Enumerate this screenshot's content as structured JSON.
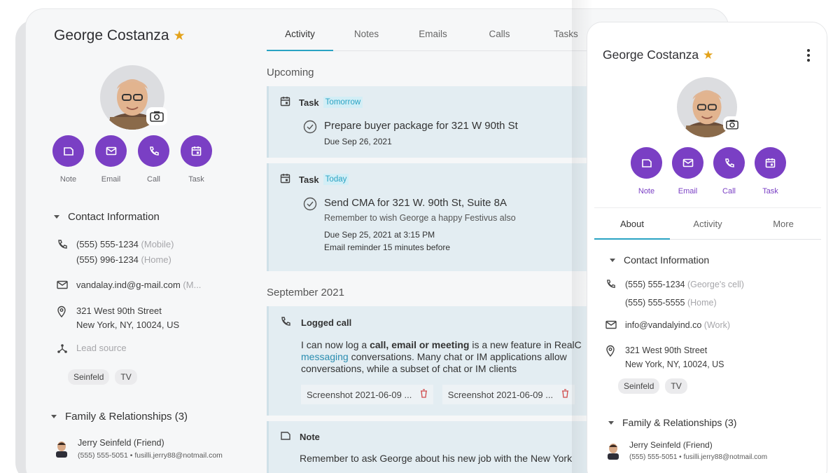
{
  "contact": {
    "name": "George Costanza"
  },
  "actions": [
    {
      "label": "Note",
      "icon": "note-icon"
    },
    {
      "label": "Email",
      "icon": "email-icon"
    },
    {
      "label": "Call",
      "icon": "phone-icon"
    },
    {
      "label": "Task",
      "icon": "calendar-icon"
    }
  ],
  "left": {
    "contact_section": "Contact Information",
    "phone1": "(555) 555-1234",
    "phone1_type": "(Mobile)",
    "phone2": "(555) 996-1234",
    "phone2_type": "(Home)",
    "email": "vandalay.ind@g-mail.com",
    "email_type": "(M...",
    "address1": "321 West 90th Street",
    "address2": "New York, NY, 10024, US",
    "lead_source": "Lead source",
    "tags": [
      "Seinfeld",
      "TV"
    ],
    "family_section": "Family & Relationships (3)",
    "relation_name": "Jerry Seinfeld (Friend)",
    "relation_detail": "(555) 555-5051 • fusilli.jerry88@notmail.com"
  },
  "tabs": [
    "Activity",
    "Notes",
    "Emails",
    "Calls",
    "Tasks"
  ],
  "activity": {
    "upcoming": "Upcoming",
    "task1": {
      "type": "Task",
      "badge": "Tomorrow",
      "title": "Prepare buyer package for 321 W 90th St",
      "due": "Due Sep 26, 2021"
    },
    "task2": {
      "type": "Task",
      "badge": "Today",
      "title": "Send CMA for 321 W. 90th St, Suite 8A",
      "note": "Remember to wish George a happy Festivus also",
      "due": "Due Sep 25, 2021 at 3:15 PM",
      "reminder": "Email reminder 15 minutes before"
    },
    "september": "September 2021",
    "call": {
      "type": "Logged call",
      "line1_a": "I can now log a ",
      "line1_b": "call, email or meeting",
      "line1_c": " is a new feature in RealC",
      "line2_a": "messaging",
      "line2_b": " conversations. Many chat or IM applications allow",
      "line3": "conversations, while a subset of chat or IM clients",
      "attachments": [
        "Screenshot 2021-06-09 ...",
        "Screenshot 2021-06-09 ..."
      ]
    },
    "note": {
      "type": "Note",
      "text": "Remember to ask George about his new job with the New York"
    }
  },
  "mobile": {
    "name": "George Costanza",
    "tabs": [
      "About",
      "Activity",
      "More"
    ],
    "contact_section": "Contact Information",
    "phone1": "(555) 555-1234",
    "phone1_type": "(George's cell)",
    "phone2": "(555) 555-5555",
    "phone2_type": "(Home)",
    "email": "info@vandalyind.co",
    "email_type": "(Work)",
    "address1": "321 West 90th Street",
    "address2": "New York, NY, 10024, US",
    "tags": [
      "Seinfeld",
      "TV"
    ],
    "family_section": "Family & Relationships (3)",
    "relation_name": "Jerry Seinfeld (Friend)",
    "relation_detail": "(555) 555-5051 • fusilli.jerry88@notmail.com"
  },
  "colors": {
    "accent_purple": "#7a3fc4",
    "accent_teal": "#2aa3c3",
    "star": "#e3a21a",
    "card_bg": "#e3edf2"
  }
}
